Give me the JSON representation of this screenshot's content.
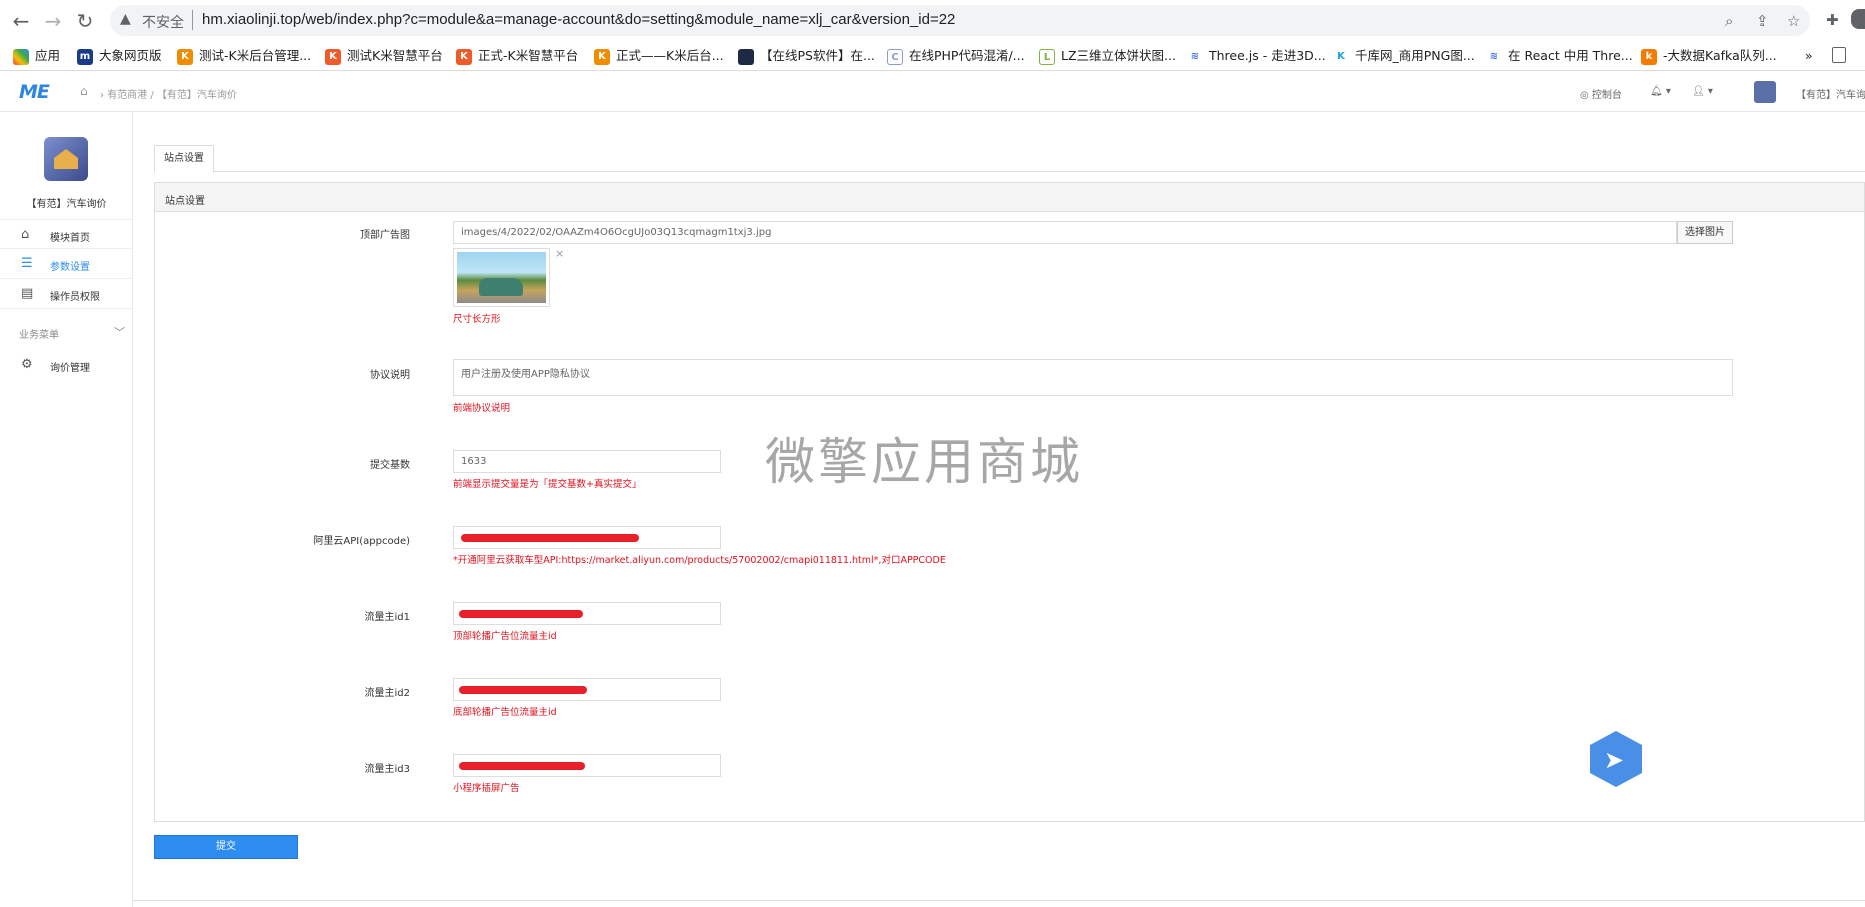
{
  "browser": {
    "back_icon": "arrow-left",
    "security_label": "不安全",
    "url": "hm.xiaolinji.top/web/index.php?c=module&a=manage-account&do=setting&module_name=xlj_car&version_id=22",
    "bookmarks": [
      {
        "label": "应用",
        "color": "#e94235"
      },
      {
        "label": "大象网页版",
        "color": "#1a3a8a"
      },
      {
        "label": "测试-K米后台管理...",
        "color": "#f08c00"
      },
      {
        "label": "测试K米智慧平台",
        "color": "#f05a28"
      },
      {
        "label": "正式-K米智慧平台",
        "color": "#f05a28"
      },
      {
        "label": "正式——K米后台...",
        "color": "#f08c00"
      },
      {
        "label": "【在线PS软件】在...",
        "color": "#1e2a44"
      },
      {
        "label": "在线PHP代码混淆/...",
        "color": "#8a9bd6"
      },
      {
        "label": "LZ三维立体饼状图...",
        "color": "#7cb342"
      },
      {
        "label": "Three.js - 走进3D...",
        "color": "#3f6fd8"
      },
      {
        "label": "千库网_商用PNG图...",
        "color": "#1aa3e8"
      },
      {
        "label": "在 React 中用 Thre...",
        "color": "#3f6fd8"
      },
      {
        "label": "-大数据Kafka队列...",
        "color": "#f57c00"
      }
    ],
    "more_label": "»"
  },
  "header": {
    "logo": "ME",
    "breadcrumb": "有范商港 / 【有范】汽车询价",
    "console_label": "控制台",
    "app_name": "【有范】汽车询价"
  },
  "sidebar": {
    "app_name": "【有范】汽车询价",
    "items": [
      {
        "label": "模块首页",
        "icon": "home-icon"
      },
      {
        "label": "参数设置",
        "icon": "list-icon"
      },
      {
        "label": "操作员权限",
        "icon": "doc-icon"
      }
    ],
    "group_label": "业务菜单",
    "group_items": [
      {
        "label": "询价管理",
        "icon": "gear-icon"
      }
    ]
  },
  "main": {
    "tab_label": "站点设置",
    "panel_title": "站点设置",
    "fields": {
      "top_ad": {
        "label": "顶部广告图",
        "value": "images/4/2022/02/OAAZm4O6OcgUJo03Q13cqmagm1txj3.jpg",
        "button": "选择图片",
        "help": "尺寸长方形"
      },
      "agreement": {
        "label": "协议说明",
        "value": "用户注册及使用APP隐私协议",
        "help": "前端协议说明"
      },
      "submit_base": {
        "label": "提交基数",
        "value": "1633",
        "help": "前端显示提交量是为「提交基数+真实提交」"
      },
      "aliyun": {
        "label": "阿里云API(appcode)",
        "help": "*开通阿里云获取车型API:https://market.aliyun.com/products/57002002/cmapi011811.html*,对口APPCODE"
      },
      "traffic1": {
        "label": "流量主id1",
        "help": "顶部轮播广告位流量主id"
      },
      "traffic2": {
        "label": "流量主id2",
        "help": "底部轮播广告位流量主id"
      },
      "traffic3": {
        "label": "流量主id3",
        "help": "小程序插屏广告"
      }
    },
    "submit_label": "提交",
    "watermark": "微擎应用商城"
  },
  "colors": {
    "accent": "#2d8cf0",
    "error": "#e5101d"
  }
}
